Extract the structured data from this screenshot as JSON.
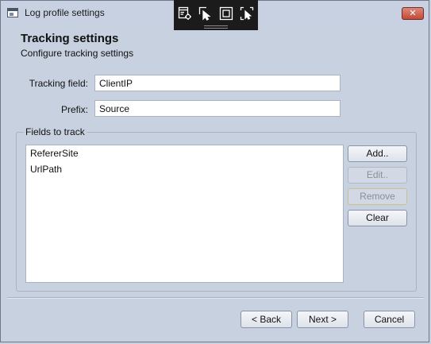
{
  "window": {
    "title": "Log profile settings",
    "close_label": "✕"
  },
  "overlay_toolbar": {
    "icons": [
      "app-settings-icon",
      "select-element-icon",
      "frame-icon",
      "screenshot-cursor-icon"
    ]
  },
  "header": {
    "title": "Tracking settings",
    "subtitle": "Configure tracking settings"
  },
  "form": {
    "tracking_field_label": "Tracking field:",
    "tracking_field_value": "ClientIP",
    "prefix_label": "Prefix:",
    "prefix_value": "Source"
  },
  "fields_group": {
    "label": "Fields to track",
    "items": [
      "RefererSite",
      "UrlPath"
    ],
    "buttons": {
      "add": "Add..",
      "edit": "Edit..",
      "remove": "Remove",
      "clear": "Clear"
    }
  },
  "footer": {
    "back": "< Back",
    "next": "Next >",
    "cancel": "Cancel"
  },
  "colors": {
    "window_bg": "#c8d1e0",
    "close_red": "#c24a3a",
    "toolbar_dark": "#1b1b1b"
  }
}
